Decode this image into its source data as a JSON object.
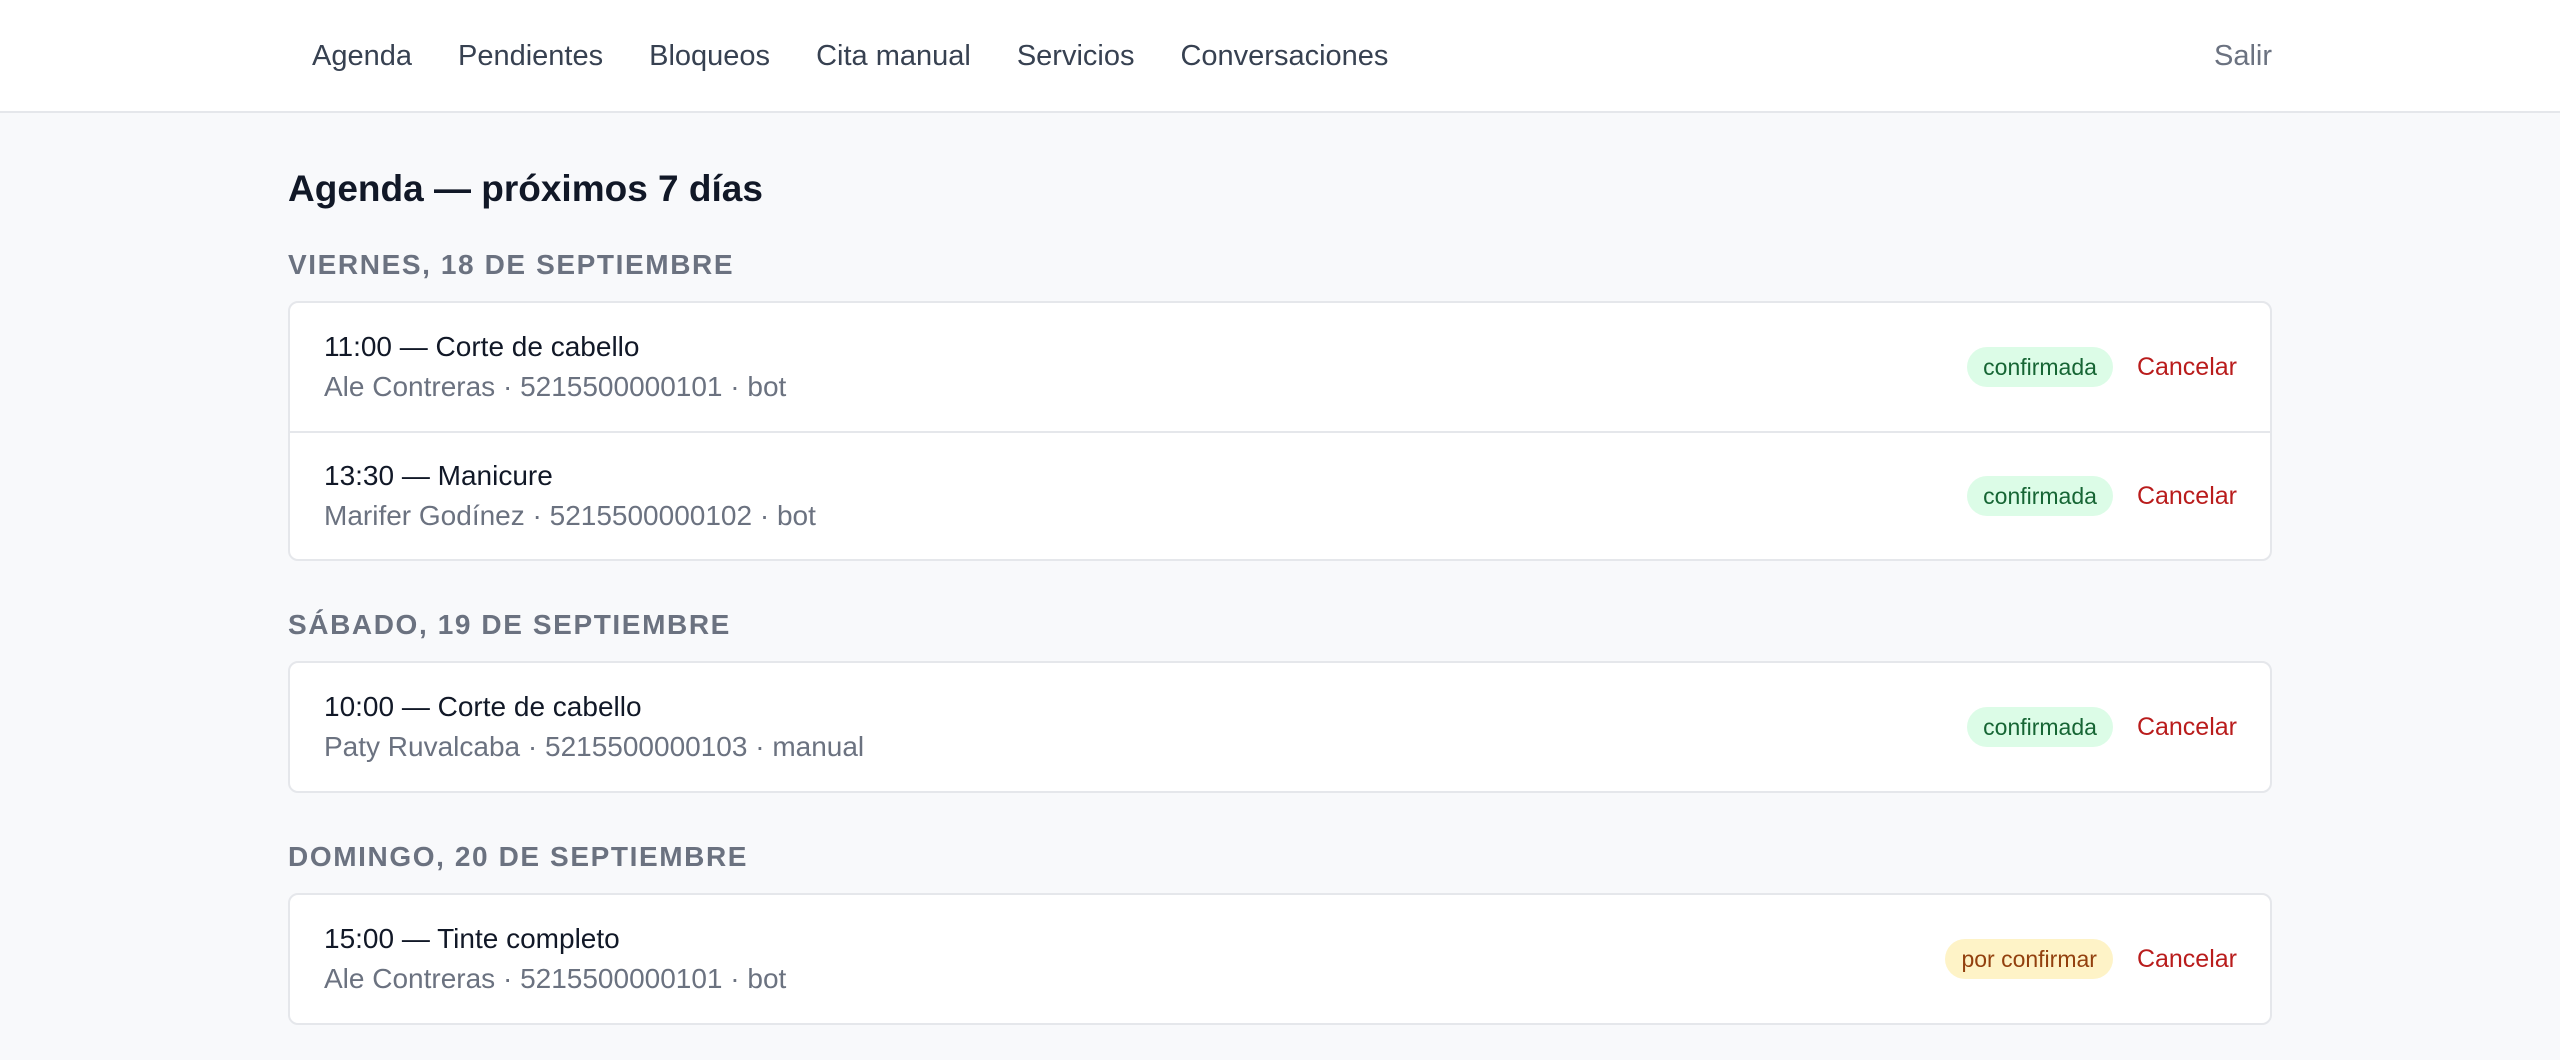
{
  "nav": {
    "items": [
      {
        "label": "Agenda"
      },
      {
        "label": "Pendientes"
      },
      {
        "label": "Bloqueos"
      },
      {
        "label": "Cita manual"
      },
      {
        "label": "Servicios"
      },
      {
        "label": "Conversaciones"
      }
    ],
    "logout_label": "Salir"
  },
  "page": {
    "title": "Agenda — próximos 7 días"
  },
  "days": [
    {
      "heading": "Viernes, 18 de septiembre",
      "appointments": [
        {
          "title": "11:00 — Corte de cabello",
          "details": "Ale Contreras · 5215500000101 · bot",
          "status": "confirmada",
          "status_type": "confirmed",
          "cancel_label": "Cancelar"
        },
        {
          "title": "13:30 — Manicure",
          "details": "Marifer Godínez · 5215500000102 · bot",
          "status": "confirmada",
          "status_type": "confirmed",
          "cancel_label": "Cancelar"
        }
      ]
    },
    {
      "heading": "Sábado, 19 de septiembre",
      "appointments": [
        {
          "title": "10:00 — Corte de cabello",
          "details": "Paty Ruvalcaba · 5215500000103 · manual",
          "status": "confirmada",
          "status_type": "confirmed",
          "cancel_label": "Cancelar"
        }
      ]
    },
    {
      "heading": "Domingo, 20 de septiembre",
      "appointments": [
        {
          "title": "15:00 — Tinte completo",
          "details": "Ale Contreras · 5215500000101 · bot",
          "status": "por confirmar",
          "status_type": "pending",
          "cancel_label": "Cancelar"
        }
      ]
    }
  ],
  "colors": {
    "confirmed_bg": "#dcfce7",
    "confirmed_text": "#166534",
    "pending_bg": "#fef3c7",
    "pending_text": "#92400e",
    "cancel": "#b91c1c"
  }
}
